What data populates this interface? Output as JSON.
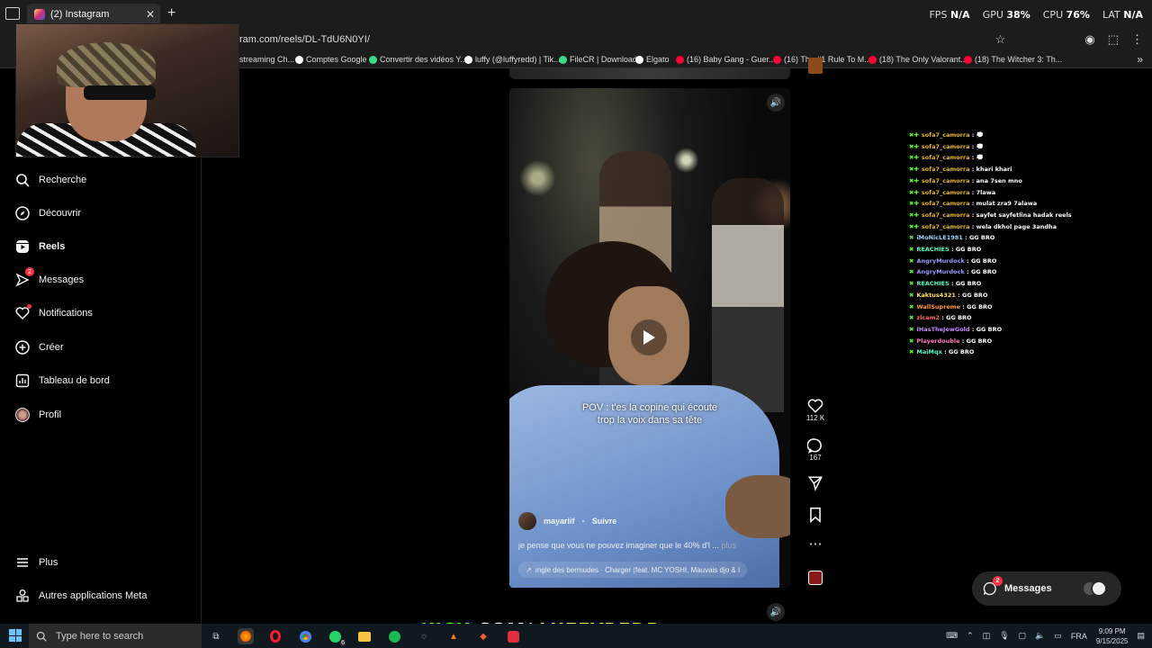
{
  "browser": {
    "tab_title": "(2) Instagram",
    "url": "ram.com/reels/DL-TdU6N0YI/",
    "bookmarks": [
      {
        "label": "streaming Ch...",
        "icon": "folder-icon"
      },
      {
        "label": "Comptes Google",
        "icon": "google-icon"
      },
      {
        "label": "Convertir des vidéos Y...",
        "icon": "download-icon"
      },
      {
        "label": "luffy (@luffyredd) | Tik...",
        "icon": "tiktok-icon"
      },
      {
        "label": "FileCR | Download",
        "icon": "filecr-icon"
      },
      {
        "label": "Elgato",
        "icon": "elgato-icon"
      },
      {
        "label": "(16) Baby Gang - Guer...",
        "icon": "youtube-icon"
      },
      {
        "label": "(16) The #1 Rule To M...",
        "icon": "youtube-icon"
      },
      {
        "label": "(18) The Only Valorant...",
        "icon": "youtube-icon"
      },
      {
        "label": "(18) The Witcher 3: Th...",
        "icon": "youtube-icon"
      }
    ]
  },
  "stats": {
    "fps_label": "FPS",
    "fps_value": "N/A",
    "gpu_label": "GPU",
    "gpu_value": "38%",
    "cpu_label": "CPU",
    "cpu_value": "76%",
    "lat_label": "LAT",
    "lat_value": "N/A"
  },
  "sidebar": {
    "items": [
      {
        "label": "Recherche",
        "icon": "search-icon"
      },
      {
        "label": "Découvrir",
        "icon": "compass-icon"
      },
      {
        "label": "Reels",
        "icon": "reels-icon"
      },
      {
        "label": "Messages",
        "icon": "messenger-icon",
        "badge": "2"
      },
      {
        "label": "Notifications",
        "icon": "heart-icon"
      },
      {
        "label": "Créer",
        "icon": "plus-icon"
      },
      {
        "label": "Tableau de bord",
        "icon": "dashboard-icon"
      },
      {
        "label": "Profil",
        "icon": "profile-avatar"
      }
    ],
    "more_label": "Plus",
    "meta_label": "Autres applications Meta"
  },
  "reel": {
    "caption_overlay": [
      "POV : t'es la copine qui écoute",
      "trop la voix dans sa tête"
    ],
    "username": "mayariif",
    "follow_label": "Suivre",
    "separator": "•",
    "description": "je pense que vous ne pouvez imaginer que le 40% d'l ...",
    "more_label": "plus",
    "audio_label": "ıngle des bermudes · Charger (feat. MC YOSHI, Mauvais djo & I",
    "likes": "112 K",
    "comments": "167"
  },
  "chat": [
    {
      "user": "sofa7_camorra",
      "msg": "💭",
      "color": "#e6b422"
    },
    {
      "user": "sofa7_camorra",
      "msg": "💭",
      "color": "#e6b422"
    },
    {
      "user": "sofa7_camorra",
      "msg": "💭",
      "color": "#e6b422"
    },
    {
      "user": "sofa7_camorra",
      "msg": "khari khari",
      "color": "#e6b422"
    },
    {
      "user": "sofa7_camorra",
      "msg": "ana 7sen mno",
      "color": "#e6b422"
    },
    {
      "user": "sofa7_camorra",
      "msg": "7lawa",
      "color": "#e6b422"
    },
    {
      "user": "sofa7_camorra",
      "msg": "mulat zra9 7alawa",
      "color": "#e6b422"
    },
    {
      "user": "sofa7_camorra",
      "msg": "sayfet sayfetlina hadak reels",
      "color": "#e6b422"
    },
    {
      "user": "sofa7_camorra",
      "msg": "wela dkhol page 3andha",
      "color": "#e6b422"
    },
    {
      "user": "iMoNicLE1981",
      "msg": "GG BRO",
      "color": "#9ad3ff"
    },
    {
      "user": "REACHIES",
      "msg": "GG BRO",
      "color": "#53fcc4"
    },
    {
      "user": "AngryMurdock",
      "msg": "GG BRO",
      "color": "#9a9aff"
    },
    {
      "user": "AngryMurdock",
      "msg": "GG BRO",
      "color": "#9a9aff"
    },
    {
      "user": "REACHIES",
      "msg": "GG BRO",
      "color": "#53fcc4"
    },
    {
      "user": "Kaktus4321",
      "msg": "GG BRO",
      "color": "#ffe066"
    },
    {
      "user": "WallSupreme",
      "msg": "GG BRO",
      "color": "#ff9a3c"
    },
    {
      "user": "zlcam2",
      "msg": "GG BRO",
      "color": "#ff6a6a"
    },
    {
      "user": "IHasTheJewGold",
      "msg": "GG BRO",
      "color": "#c58aff"
    },
    {
      "user": "Playerdouble",
      "msg": "GG BRO",
      "color": "#ff7ab8"
    },
    {
      "user": "MaiMqx",
      "msg": "GG BRO",
      "color": "#53fcc4"
    }
  ],
  "messages_pill": {
    "label": "Messages",
    "badge": "2"
  },
  "overlay": {
    "kick_a": "KICK",
    "kick_b": ".COM/ ",
    "kick_c": "LUFFYREDD"
  },
  "taskbar": {
    "search_placeholder": "Type here to search",
    "lang": "FRA",
    "time": "9:09 PM",
    "date": "9/15/2025",
    "whatsapp_badge": "6"
  }
}
